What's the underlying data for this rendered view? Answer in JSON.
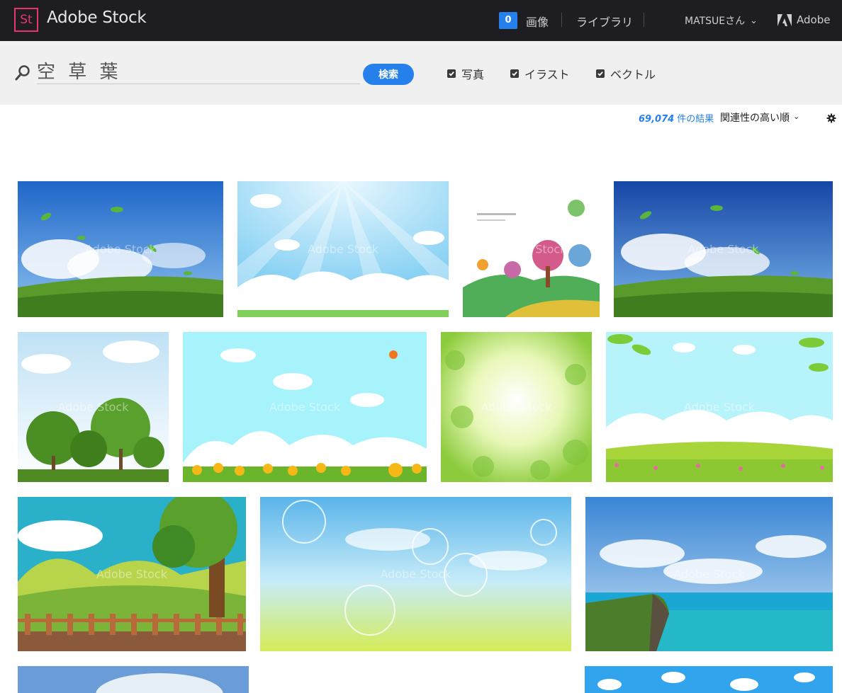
{
  "header": {
    "logo_text": "St",
    "brand": "Adobe Stock",
    "cart_count": "0",
    "nav": {
      "images": "画像",
      "library": "ライブラリ",
      "user": "MATSUEさん",
      "adobe": "Adobe"
    }
  },
  "search": {
    "query": "空 草 葉",
    "button_label": "検索",
    "filters": [
      {
        "label": "写真",
        "checked": true
      },
      {
        "label": "イラスト",
        "checked": true
      },
      {
        "label": "ベクトル",
        "checked": true
      }
    ]
  },
  "results": {
    "count": "69,074",
    "suffix": " 件の結果",
    "sort_label": "関連性の高い順"
  },
  "watermark": "Adobe Stock",
  "thumbnails": [
    {
      "subject": "sky-leaves-grass"
    },
    {
      "subject": "sunburst-clouds-flowers"
    },
    {
      "subject": "watercolor-trees"
    },
    {
      "subject": "sky-leaves-grass-2"
    },
    {
      "subject": "trees-white-sky"
    },
    {
      "subject": "sunflower-field"
    },
    {
      "subject": "clover-bokeh"
    },
    {
      "subject": "leaf-frame-meadow"
    },
    {
      "subject": "park-tree-fence"
    },
    {
      "subject": "bubbles-meadow"
    },
    {
      "subject": "ocean-cliff"
    },
    {
      "subject": "sky-partial"
    },
    {
      "subject": "cloud-partial"
    }
  ],
  "colors": {
    "accent": "#2680eb",
    "header_bg": "#1d1d22",
    "logo": "#e8366b",
    "search_bg": "#f0f0f0"
  }
}
